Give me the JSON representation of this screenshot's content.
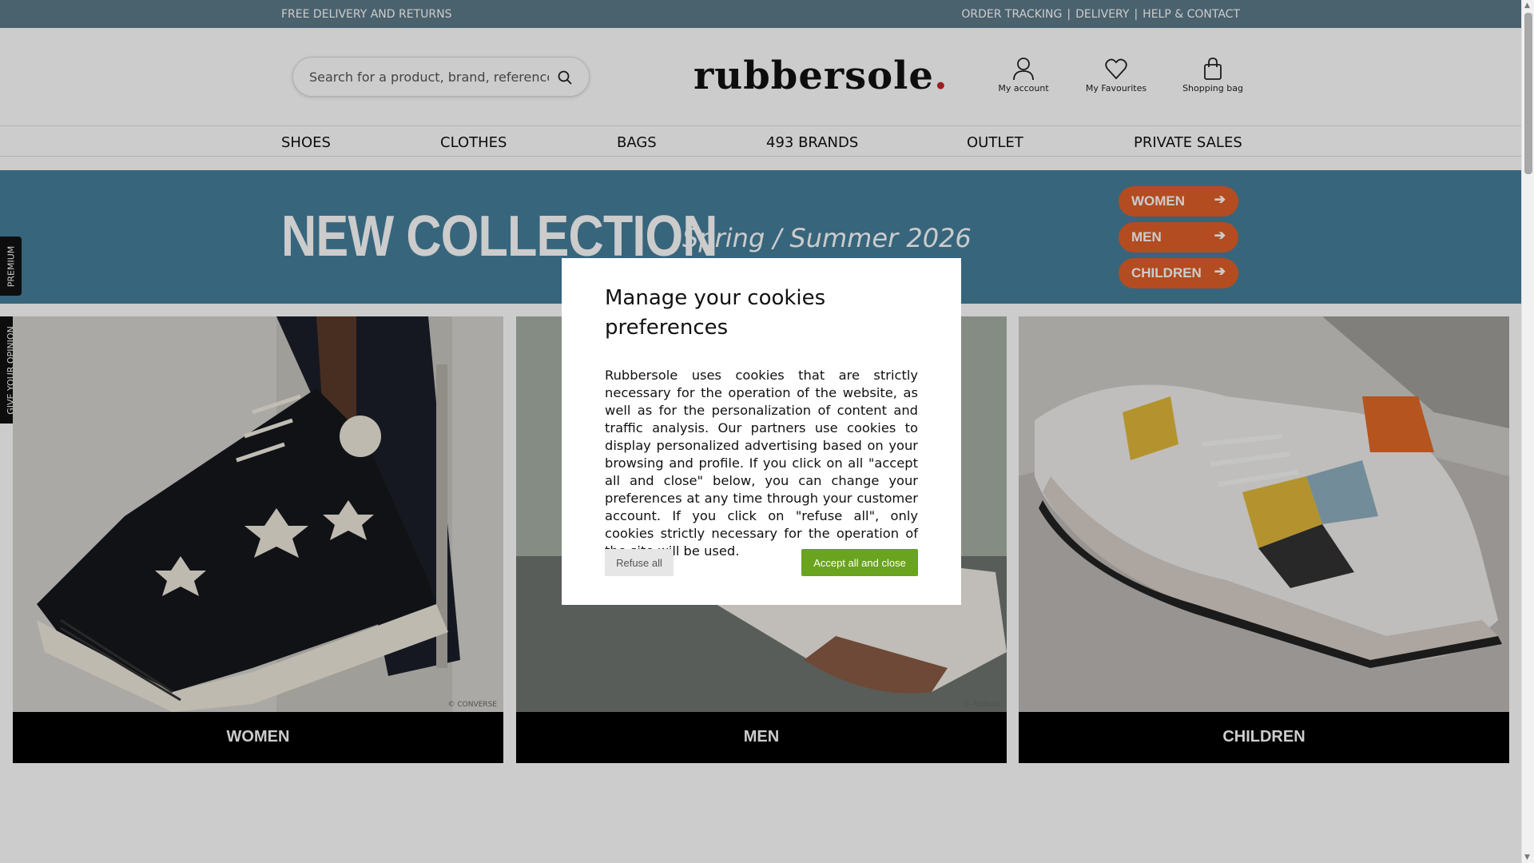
{
  "topbar": {
    "left": "FREE DELIVERY AND RETURNS",
    "links": [
      "ORDER TRACKING",
      "DELIVERY",
      "HELP & CONTACT"
    ],
    "separator": "|"
  },
  "header": {
    "search_placeholder": "Search for a product, brand, reference",
    "logo": "rubbersole",
    "logo_dot": ".",
    "account": "My account",
    "favourites": "My Favourites",
    "bag": "Shopping bag"
  },
  "nav": {
    "items": [
      "SHOES",
      "CLOTHES",
      "BAGS",
      "493 BRANDS",
      "OUTLET",
      "PRIVATE SALES"
    ]
  },
  "banner": {
    "title": "NEW COLLECTION",
    "subtitle": "Spring / Summer 2026",
    "pills": [
      "WOMEN",
      "MEN",
      "CHILDREN"
    ],
    "arrow": "➔"
  },
  "sidetabs": [
    "PREMIUM",
    "GIVE YOUR OPINION"
  ],
  "cards": [
    {
      "label": "WOMEN",
      "credit": "© CONVERSE"
    },
    {
      "label": "MEN",
      "credit": "© ADIDAS"
    },
    {
      "label": "CHILDREN",
      "credit": ""
    }
  ],
  "cookie_modal": {
    "title": "Manage your cookies preferences",
    "body": "Rubbersole uses cookies that are strictly necessary for the operation of the website, as well as for the personalization of content and traffic analysis. Our partners use cookies to display personalized advertising based on your browsing and profile. If you click on all \"accept all and close\" below, you can change your preferences at any time through your customer account. If you click on \"refuse all\", only cookies strictly necessary for the operation of the site will be used.",
    "refuse": "Refuse all",
    "accept": "Accept all and close"
  },
  "colors": {
    "topbar": "#5d7a8a",
    "banner": "#457f9c",
    "pill": "#e0602a",
    "accept": "#6aa31e",
    "logo_dot": "#c7252a"
  }
}
